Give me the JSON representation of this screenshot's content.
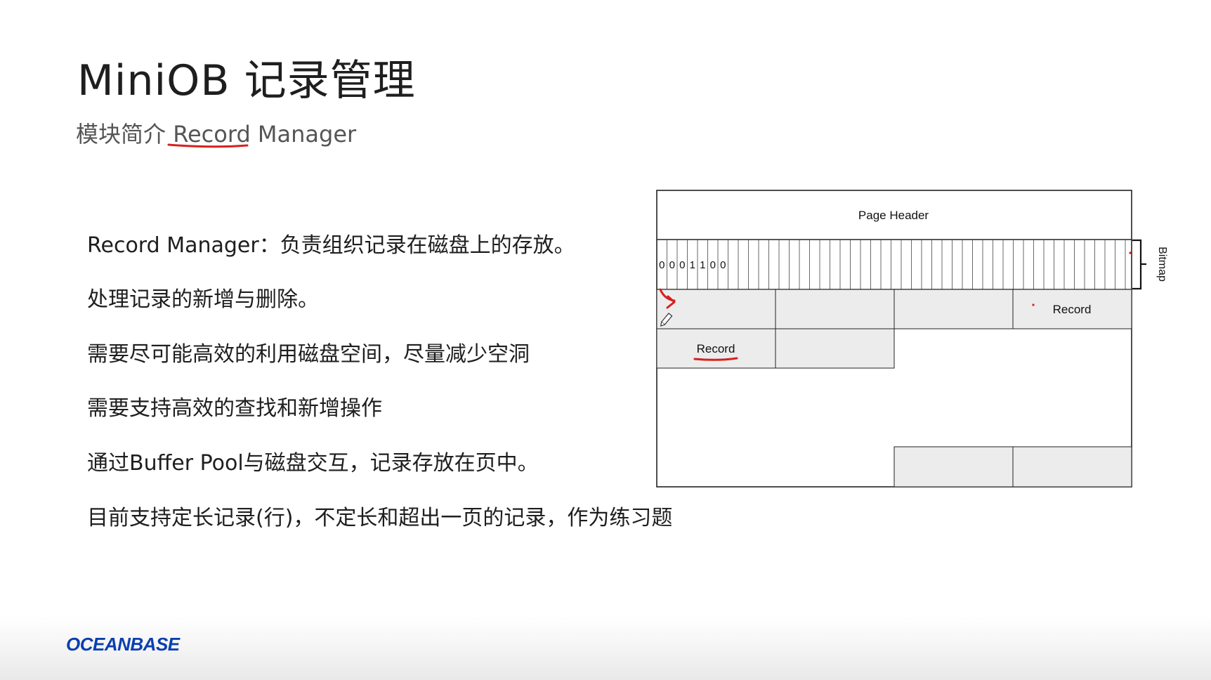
{
  "slide": {
    "title": "MiniOB 记录管理",
    "subtitle": "模块简介 Record Manager",
    "subtitle_prefix": "模块简介 ",
    "subtitle_term": "Record",
    "subtitle_suffix": " Manager",
    "bullets": [
      "Record Manager：负责组织记录在磁盘上的存放。",
      "处理记录的新增与删除。",
      "需要尽可能高效的利用磁盘空间，尽量减少空洞",
      "需要支持高效的查找和新增操作",
      "通过Buffer Pool与磁盘交互，记录存放在页中。",
      "目前支持定长记录(行)，不定长和超出一页的记录，作为练习题"
    ]
  },
  "diagram": {
    "page_header_label": "Page Header",
    "bitmap_label": "Bitmap",
    "bitmap_bits": [
      "0",
      "0",
      "0",
      "1",
      "1",
      "0",
      "0"
    ],
    "record_label_1": "Record",
    "record_label_2": "Record"
  },
  "footer": {
    "logo_text": "OCEANBASE"
  },
  "colors": {
    "annotation_red": "#d6201f",
    "cell_fill": "#ececec",
    "logo_blue": "#0a3fb0"
  }
}
